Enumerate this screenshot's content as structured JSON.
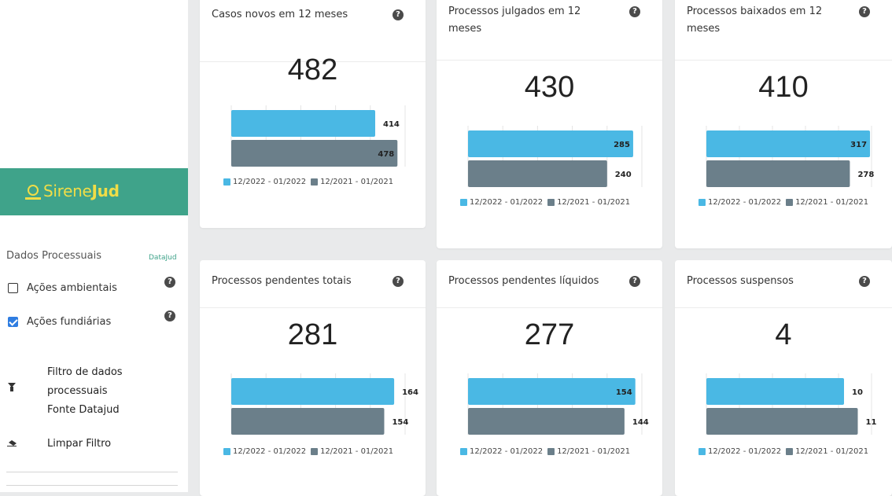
{
  "sidebar": {
    "brand_prefix": "Sirene",
    "brand_bold": "Jud",
    "section_title": "Dados Processuais",
    "section_tag": "DataJud",
    "checks": [
      {
        "label": "Ações ambientais",
        "checked": false
      },
      {
        "label": "Ações fundiárias",
        "checked": true
      }
    ],
    "filter_line1": "Filtro de dados",
    "filter_line2": "processuais",
    "filter_line3": "Fonte Datajud",
    "clear_label": "Limpar Filtro",
    "help_glyph": "?"
  },
  "legend": {
    "current": "12/2022 - 01/2022",
    "previous": "12/2021 - 01/2021",
    "current_color": "#4ab8e4",
    "previous_color": "#6b7f8a"
  },
  "cards": [
    {
      "title_line1": "Casos novos em 12 meses",
      "title_line2": "",
      "total": "482",
      "current": 414,
      "previous": 478,
      "axis_max": 500
    },
    {
      "title_line1": "Processos julgados em 12",
      "title_line2": "meses",
      "total": "430",
      "current": 285,
      "previous": 240,
      "axis_max": 300
    },
    {
      "title_line1": "Processos baixados em 12",
      "title_line2": "meses",
      "total": "410",
      "current": 317,
      "previous": 278,
      "axis_max": 320
    },
    {
      "title_line1": "Processos pendentes totais",
      "title_line2": "",
      "total": "281",
      "current": 164,
      "previous": 154,
      "axis_max": 175
    },
    {
      "title_line1": "Processos pendentes líquidos",
      "title_line2": "",
      "total": "277",
      "current": 154,
      "previous": 144,
      "axis_max": 160
    },
    {
      "title_line1": "Processos suspensos",
      "title_line2": "",
      "total": "4",
      "current": 10,
      "previous": 11,
      "axis_max": 12
    }
  ]
}
